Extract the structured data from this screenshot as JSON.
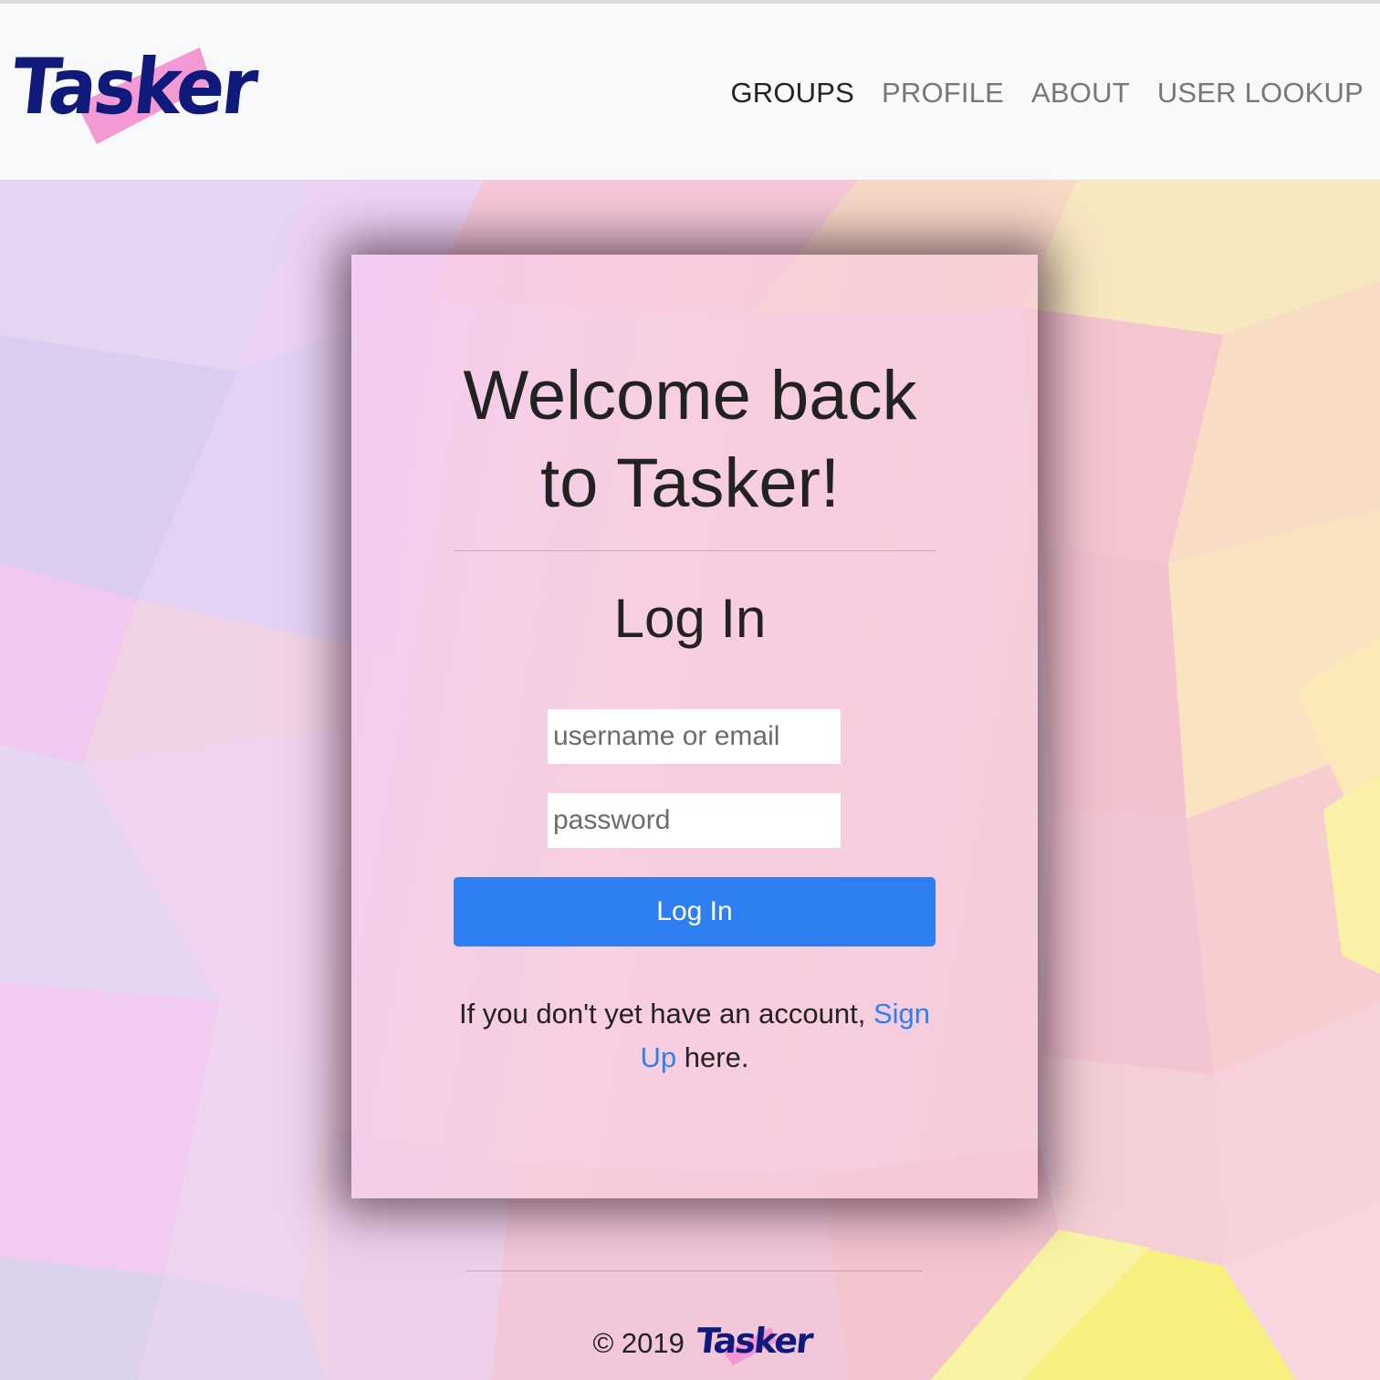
{
  "brand": {
    "name": "Tasker",
    "accent_color": "#f28fd0",
    "text_color": "#101a7a"
  },
  "nav": {
    "items": [
      {
        "label": "GROUPS",
        "active": true
      },
      {
        "label": "PROFILE",
        "active": false
      },
      {
        "label": "ABOUT",
        "active": false
      },
      {
        "label": "USER LOOKUP",
        "active": false
      }
    ]
  },
  "card": {
    "welcome_line1": "Welcome back",
    "welcome_line2": "to Tasker!",
    "login_title": "Log In",
    "username_placeholder": "username or email",
    "password_placeholder": "password",
    "login_button": "Log In",
    "signup_prefix": "If you don't yet have an account, ",
    "signup_link": "Sign Up",
    "signup_suffix": " here."
  },
  "footer": {
    "copyright": "© 2019",
    "brand": "Tasker"
  },
  "colors": {
    "primary": "#2d7ff2",
    "navbar_bg": "#f8f9fa"
  }
}
